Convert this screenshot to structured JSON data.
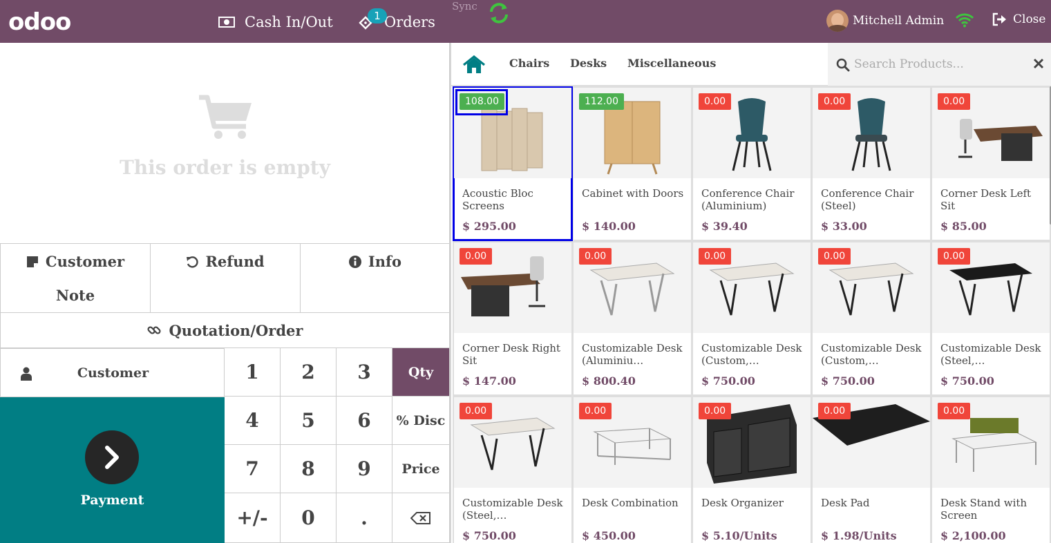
{
  "topbar": {
    "logo": "odoo",
    "cash_label": "Cash In/Out",
    "orders_label": "Orders",
    "orders_count": "1",
    "sync_label": "Sync",
    "user_name": "Mitchell Admin",
    "close_label": "Close",
    "bg_color": "#714b67"
  },
  "order": {
    "empty_text": "This order is empty"
  },
  "controls": {
    "customer_note_l1": "Customer",
    "customer_note_l2": "Note",
    "refund": "Refund",
    "info": "Info",
    "quotation": "Quotation/Order",
    "customer": "Customer",
    "payment": "Payment"
  },
  "numpad": {
    "keys": [
      "1",
      "2",
      "3",
      "Qty",
      "4",
      "5",
      "6",
      "% Disc",
      "7",
      "8",
      "9",
      "Price",
      "+/-",
      "0",
      ".",
      "⌫"
    ],
    "active_mode": "Qty"
  },
  "categories": {
    "items": [
      "Chairs",
      "Desks",
      "Miscellaneous"
    ],
    "search_placeholder": "Search Products..."
  },
  "products": [
    {
      "name": "Acoustic Bloc Screens",
      "price": "$ 295.00",
      "tag": "108.00",
      "tag_color": "green",
      "selected": true
    },
    {
      "name": "Cabinet with Doors",
      "price": "$ 140.00",
      "tag": "112.00",
      "tag_color": "green"
    },
    {
      "name": "Conference Chair (Aluminium)",
      "price": "$ 39.40",
      "tag": "0.00",
      "tag_color": "red"
    },
    {
      "name": "Conference Chair (Steel)",
      "price": "$ 33.00",
      "tag": "0.00",
      "tag_color": "red"
    },
    {
      "name": "Corner Desk Left Sit",
      "price": "$ 85.00",
      "tag": "0.00",
      "tag_color": "red"
    },
    {
      "name": "Corner Desk Right Sit",
      "price": "$ 147.00",
      "tag": "0.00",
      "tag_color": "red"
    },
    {
      "name": "Customizable Desk (Aluminiu…",
      "price": "$ 800.40",
      "tag": "0.00",
      "tag_color": "red"
    },
    {
      "name": "Customizable Desk (Custom,…",
      "price": "$ 750.00",
      "tag": "0.00",
      "tag_color": "red"
    },
    {
      "name": "Customizable Desk (Custom,…",
      "price": "$ 750.00",
      "tag": "0.00",
      "tag_color": "red"
    },
    {
      "name": "Customizable Desk (Steel,…",
      "price": "$ 750.00",
      "tag": "0.00",
      "tag_color": "red"
    },
    {
      "name": "Customizable Desk (Steel,…",
      "price": "$ 750.00",
      "tag": "0.00",
      "tag_color": "red"
    },
    {
      "name": "Desk Combination",
      "price": "$ 450.00",
      "tag": "0.00",
      "tag_color": "red"
    },
    {
      "name": "Desk Organizer",
      "price": "$ 5.10/Units",
      "tag": "0.00",
      "tag_color": "red"
    },
    {
      "name": "Desk Pad",
      "price": "$ 1.98/Units",
      "tag": "0.00",
      "tag_color": "red"
    },
    {
      "name": "Desk Stand with Screen",
      "price": "$ 2,100.00",
      "tag": "0.00",
      "tag_color": "red"
    }
  ]
}
